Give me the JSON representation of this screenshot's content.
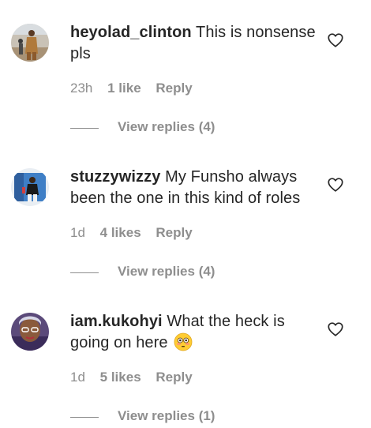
{
  "comments": [
    {
      "username": "heyolad_clinton",
      "text": "This is nonsense pls",
      "time": "23h",
      "likes": "1 like",
      "reply_label": "Reply",
      "view_replies": "View replies (4)",
      "avatar": "profile-photo-man-outdoors"
    },
    {
      "username": "stuzzywizzy",
      "text": "My Funsho always been the one in this kind of roles",
      "time": "1d",
      "likes": "4 likes",
      "reply_label": "Reply",
      "view_replies": "View replies (4)",
      "avatar": "profile-photo-man-blue-background"
    },
    {
      "username": "iam.kukohyi",
      "text": "What the heck is going on here",
      "emoji": "flushed-face-emoji",
      "time": "1d",
      "likes": "5 likes",
      "reply_label": "Reply",
      "view_replies": "View replies (1)",
      "avatar": "profile-photo-woman-glasses"
    }
  ],
  "colors": {
    "text": "#262626",
    "secondary": "#8e8e8e",
    "background": "#ffffff"
  }
}
